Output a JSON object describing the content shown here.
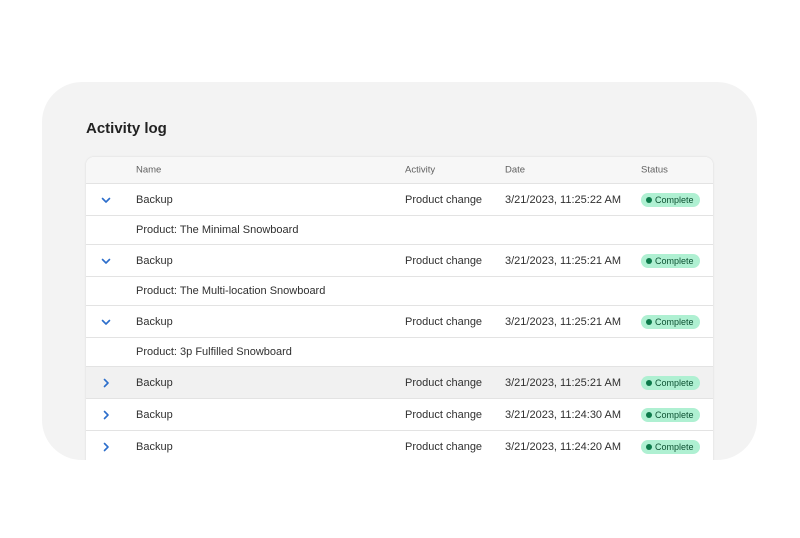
{
  "title": "Activity log",
  "columns": [
    "Name",
    "Activity",
    "Date",
    "Status"
  ],
  "rows": [
    {
      "name": "Backup",
      "activity": "Product change",
      "date": "3/21/2023, 11:25:22 AM",
      "status": "Complete",
      "expanded": true,
      "detail": "Product: The Minimal Snowboard"
    },
    {
      "name": "Backup",
      "activity": "Product change",
      "date": "3/21/2023, 11:25:21 AM",
      "status": "Complete",
      "expanded": true,
      "detail": "Product: The Multi-location Snowboard"
    },
    {
      "name": "Backup",
      "activity": "Product change",
      "date": "3/21/2023, 11:25:21 AM",
      "status": "Complete",
      "expanded": true,
      "detail": "Product: 3p Fulfilled Snowboard"
    },
    {
      "name": "Backup",
      "activity": "Product change",
      "date": "3/21/2023, 11:25:21 AM",
      "status": "Complete",
      "expanded": false,
      "hover": true
    },
    {
      "name": "Backup",
      "activity": "Product change",
      "date": "3/21/2023, 11:24:30 AM",
      "status": "Complete",
      "expanded": false
    },
    {
      "name": "Backup",
      "activity": "Product change",
      "date": "3/21/2023, 11:24:20 AM",
      "status": "Complete",
      "expanded": false
    }
  ],
  "colors": {
    "accent": "#2c6ecb",
    "badge_bg": "#aff0d2",
    "badge_text": "#0c5132"
  }
}
